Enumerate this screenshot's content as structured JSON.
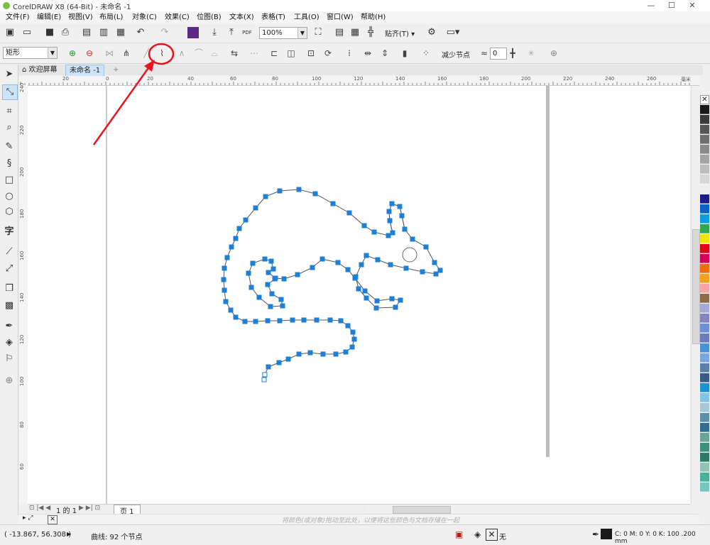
{
  "window": {
    "title": "CorelDRAW X8 (64-Bit) - 未命名 -1",
    "minimize": "—",
    "maximize": "☐",
    "close": "✕"
  },
  "menu": [
    "文件(F)",
    "编辑(E)",
    "视图(V)",
    "布局(L)",
    "对象(C)",
    "效果(C)",
    "位图(B)",
    "文本(X)",
    "表格(T)",
    "工具(O)",
    "窗口(W)",
    "帮助(H)"
  ],
  "toolbar1": {
    "zoom_value": "100%",
    "snap_label": "贴齐(T)",
    "pdf_label": "PDF"
  },
  "toolbar2": {
    "shape_combo": "矩形",
    "reduce_nodes_label": "减少节点",
    "smoothing_value": "0"
  },
  "tabs": {
    "welcome": "欢迎屏幕",
    "document": "未命名 -1",
    "add": "+"
  },
  "ruler_top": [
    "20",
    "0",
    "20",
    "40",
    "60",
    "80",
    "100",
    "120",
    "140",
    "160",
    "180",
    "200",
    "220",
    "240",
    "260"
  ],
  "ruler_top_unit": "毫米",
  "ruler_left": [
    "240",
    "220",
    "200",
    "180",
    "160",
    "140",
    "120",
    "100",
    "80",
    "60"
  ],
  "page_nav": {
    "page_indicator": "1 的 1",
    "page_tab": "页 1"
  },
  "color_strip_hint": "将颜色(或对象)拖动至此处，以便将这些颜色与文档存储在一起",
  "status": {
    "coords": "( -13.867, 56.308 )",
    "selection_info": "曲线: 92 个节点",
    "fill_none": "无",
    "outline_info": "C: 0 M: 0 Y: 0 K: 100  .200 mm"
  },
  "palette_colors": [
    "#1a1a1a",
    "#3a3a3a",
    "#555555",
    "#6f6f6f",
    "#8a8a8a",
    "#a3a3a3",
    "#bdbdbd",
    "#d6d6d6",
    "#efefef",
    "#1c1f8a",
    "#0b63c5",
    "#0aa0dc",
    "#2fa84f",
    "#f2e600",
    "#e8001a",
    "#d6005c",
    "#ee6b14",
    "#f4a11b",
    "#f5a5a5",
    "#8b6b4a",
    "#a8a7d8",
    "#8585c2",
    "#6f8fd8",
    "#6c7bbf",
    "#4a90d9",
    "#7aa7e0",
    "#5c7fa8",
    "#3a5a8a",
    "#1b93d3",
    "#84c3e8",
    "#a9c7d6",
    "#5d8fa8",
    "#2e6e8e",
    "#6aa39a",
    "#3f8f7f",
    "#2b7a6a",
    "#8fc4b0",
    "#4ab09a",
    "#76c7c0"
  ],
  "annotation": {
    "color": "#e8141e"
  }
}
